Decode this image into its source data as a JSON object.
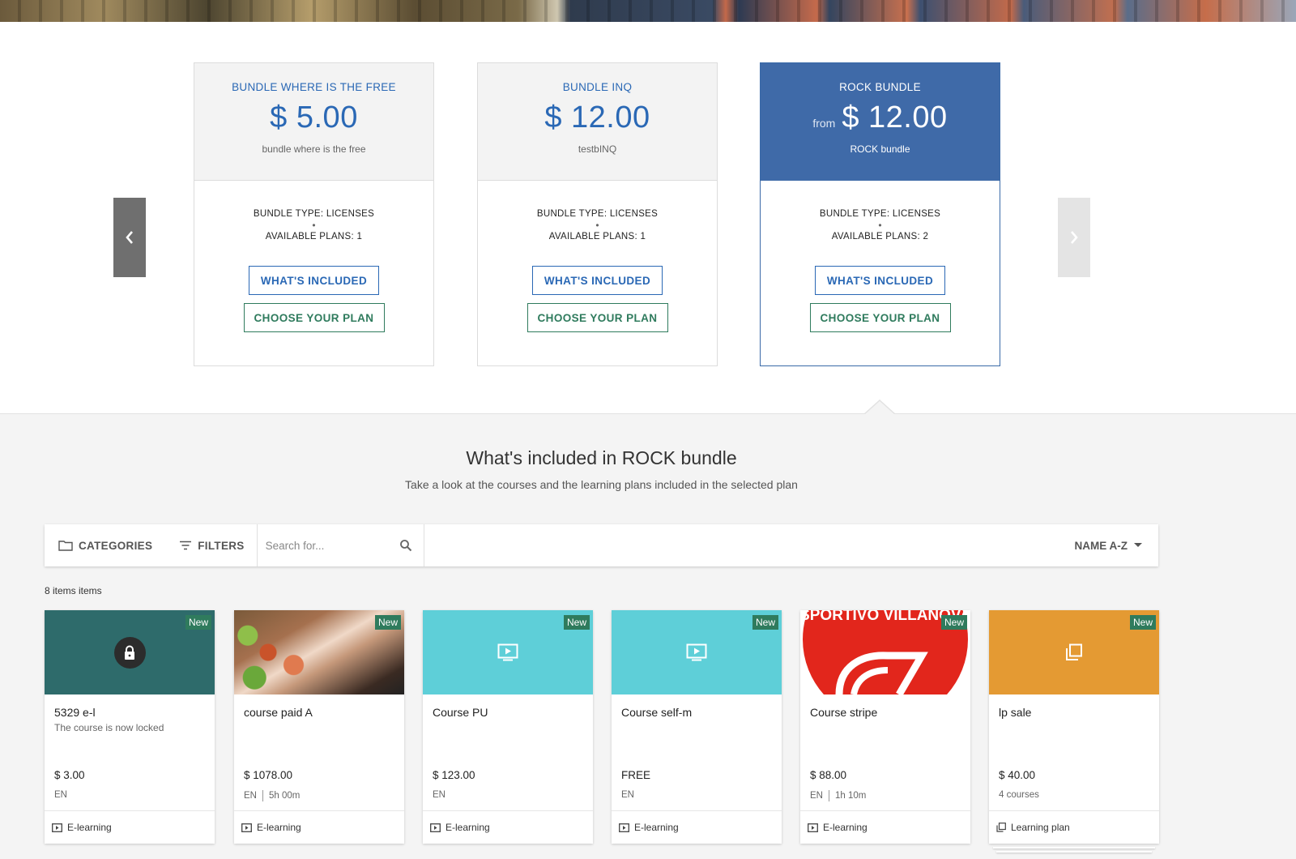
{
  "bundles": [
    {
      "name": "BUNDLE WHERE IS THE FREE",
      "from": "",
      "price": "$ 5.00",
      "description": "bundle where is the free",
      "type": "BUNDLE TYPE: LICENSES",
      "plans": "AVAILABLE PLANS: 1",
      "included_label": "WHAT'S INCLUDED",
      "choose_label": "CHOOSE YOUR PLAN"
    },
    {
      "name": "BUNDLE INQ",
      "from": "",
      "price": "$ 12.00",
      "description": "testbINQ",
      "type": "BUNDLE TYPE: LICENSES",
      "plans": "AVAILABLE PLANS: 1",
      "included_label": "WHAT'S INCLUDED",
      "choose_label": "CHOOSE YOUR PLAN"
    },
    {
      "name": "ROCK BUNDLE",
      "from": "from",
      "price": "$ 12.00",
      "description": "ROCK bundle",
      "type": "BUNDLE TYPE: LICENSES",
      "plans": "AVAILABLE PLANS: 2",
      "included_label": "WHAT'S INCLUDED",
      "choose_label": "CHOOSE YOUR PLAN"
    }
  ],
  "included": {
    "title": "What's included in ROCK bundle",
    "subtitle": "Take a look at the courses and the learning plans included in the selected plan"
  },
  "filter_bar": {
    "categories_label": "CATEGORIES",
    "filters_label": "FILTERS",
    "search_placeholder": "Search for...",
    "sort_label": "NAME A-Z"
  },
  "items_count": "8 items items",
  "badge_new": "New",
  "courses": [
    {
      "name": "5329 e-l",
      "note": "The course is now locked",
      "price": "$ 3.00",
      "lang": "EN",
      "duration": "",
      "type": "E-learning",
      "thumb_color": "#2e6b6b"
    },
    {
      "name": "course paid A",
      "note": "",
      "price": "$ 1078.00",
      "lang": "EN",
      "duration": "5h 00m",
      "type": "E-learning",
      "thumb_color": "#7a5a3a"
    },
    {
      "name": "Course PU",
      "note": "",
      "price": "$ 123.00",
      "lang": "EN",
      "duration": "",
      "type": "E-learning",
      "thumb_color": "#5ecfd8"
    },
    {
      "name": "Course self-m",
      "note": "",
      "price": "FREE",
      "lang": "EN",
      "duration": "",
      "type": "E-learning",
      "thumb_color": "#5ecfd8"
    },
    {
      "name": "Course stripe",
      "note": "",
      "price": "$ 88.00",
      "lang": "EN",
      "duration": "1h 10m",
      "type": "E-learning",
      "thumb_color": "#e2261c",
      "logo_text": "SPORTIVO VILLANOVA"
    },
    {
      "name": "lp sale",
      "note": "",
      "price": "$ 40.00",
      "lang": "4 courses",
      "duration": "",
      "type": "Learning plan",
      "thumb_color": "#e49a33"
    }
  ],
  "colors": {
    "accent_blue": "#2a68b5",
    "selected_bundle": "#3f6aa8",
    "accent_green": "#2f7b5d"
  }
}
